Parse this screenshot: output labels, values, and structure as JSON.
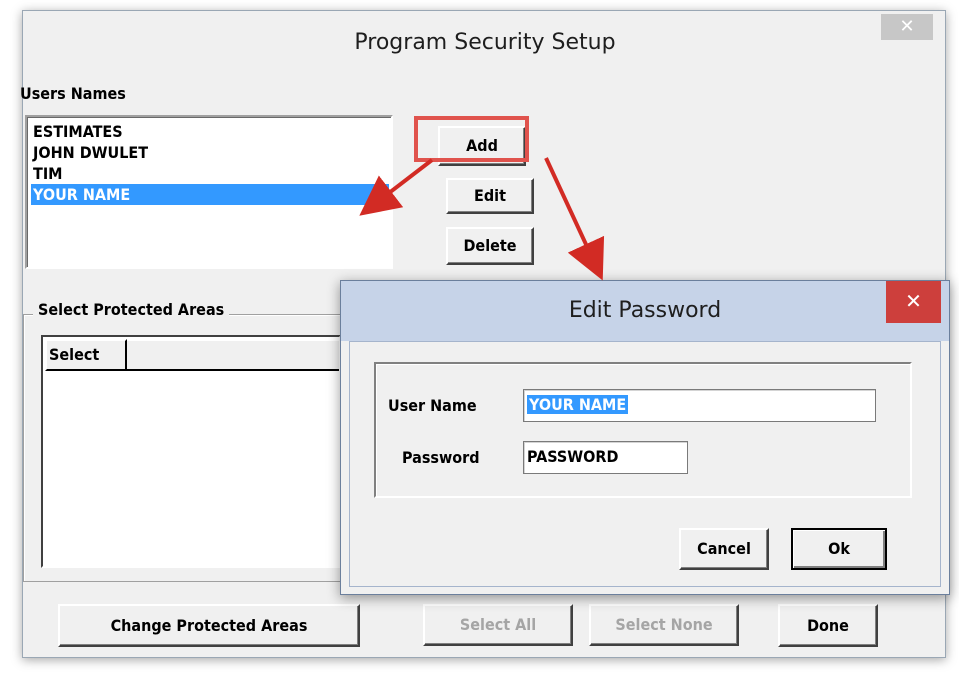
{
  "main_window": {
    "title": "Program Security Setup",
    "close_glyph": "✕",
    "users_label": "Users Names",
    "users": [
      {
        "name": "ESTIMATES",
        "selected": false
      },
      {
        "name": "JOHN DWULET",
        "selected": false
      },
      {
        "name": "TIM",
        "selected": false
      },
      {
        "name": "YOUR NAME",
        "selected": true
      }
    ],
    "buttons": {
      "add": "Add",
      "edit": "Edit",
      "delete": "Delete",
      "change_protected_areas": "Change Protected Areas",
      "select_all": "Select All",
      "select_none": "Select None",
      "done": "Done"
    },
    "protected_areas": {
      "group_label": "Select Protected Areas",
      "column_select": "Select"
    }
  },
  "dialog": {
    "title": "Edit Password",
    "close_glyph": "✕",
    "user_name_label": "User Name",
    "user_name_value": "YOUR NAME",
    "password_label": "Password",
    "password_value": "PASSWORD",
    "cancel_label": "Cancel",
    "ok_label": "Ok"
  },
  "annotation": {
    "highlight_color": "#e0534d",
    "arrow_color": "#d22b24",
    "selection_color": "#3399ff",
    "dialog_title_bar_color": "#c6d3e8",
    "close_button_color": "#cd3f3c"
  }
}
